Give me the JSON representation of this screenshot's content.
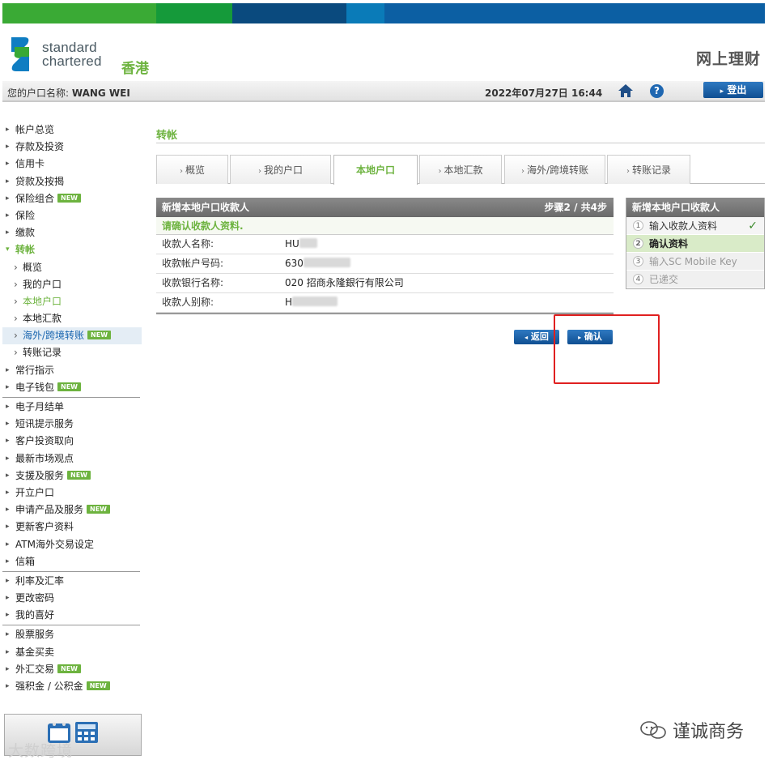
{
  "header": {
    "brand_line1": "standard",
    "brand_line2": "chartered",
    "brand_region": "香港",
    "service_title": "网上理财",
    "colors": {
      "bar_green1": "#3aaa35",
      "bar_green2": "#159a3a",
      "bar_navy": "#0a4a7e",
      "bar_teal": "#0a7bb8",
      "bar_blue": "#0c5fa3",
      "accent_green": "#6db33f"
    }
  },
  "userbar": {
    "account_label": "您的户口名称:",
    "account_name": "WANG WEI",
    "datetime": "2022年07月27日 16:44",
    "home_icon": "home-icon",
    "help_icon": "help-icon",
    "help_glyph": "?",
    "logout_label": "登出"
  },
  "sidebar": {
    "group1": [
      {
        "label": "帐户总览"
      },
      {
        "label": "存款及投资"
      },
      {
        "label": "信用卡"
      },
      {
        "label": "贷款及按揭"
      },
      {
        "label": "保险组合",
        "badge": "NEW"
      },
      {
        "label": "保险"
      },
      {
        "label": "缴款"
      },
      {
        "label": "转帐"
      }
    ],
    "transfer_sub": [
      {
        "label": "概览"
      },
      {
        "label": "我的户口"
      },
      {
        "label": "本地户口"
      },
      {
        "label": "本地汇款"
      },
      {
        "label": "海外/跨境转账",
        "badge": "NEW"
      },
      {
        "label": "转账记录"
      }
    ],
    "group1b": [
      {
        "label": "常行指示"
      },
      {
        "label": "电子钱包",
        "badge": "NEW"
      }
    ],
    "group2": [
      {
        "label": "电子月结单"
      },
      {
        "label": "短讯提示服务"
      },
      {
        "label": "客户投资取向"
      },
      {
        "label": "最新市场观点"
      },
      {
        "label": "支援及服务",
        "badge": "NEW"
      },
      {
        "label": "开立户口"
      },
      {
        "label": "申请产品及服务",
        "badge": "NEW"
      },
      {
        "label": "更新客户资料"
      },
      {
        "label": "ATM海外交易设定"
      },
      {
        "label": "信箱"
      }
    ],
    "group3": [
      {
        "label": "利率及汇率"
      },
      {
        "label": "更改密码"
      },
      {
        "label": "我的喜好"
      }
    ],
    "group4": [
      {
        "label": "股票服务"
      },
      {
        "label": "基金买卖"
      },
      {
        "label": "外汇交易",
        "badge": "NEW"
      },
      {
        "label": "强积金 / 公积金",
        "badge": "NEW"
      }
    ]
  },
  "page": {
    "title": "转帐",
    "tabs": [
      {
        "label": "概览"
      },
      {
        "label": "我的户口"
      },
      {
        "label": "本地户口"
      },
      {
        "label": "本地汇款"
      },
      {
        "label": "海外/跨境转账"
      },
      {
        "label": "转账记录"
      }
    ]
  },
  "form": {
    "panel_title": "新增本地户口收款人",
    "step_text": "步骤2 / 共4步",
    "confirm_prompt": "请确认收款人资料.",
    "rows": [
      {
        "label": "收款人名称:",
        "value": "HU"
      },
      {
        "label": "收款帐户号码:",
        "value": "630"
      },
      {
        "label": "收款银行名称:",
        "value": "020 招商永隆銀行有限公司"
      },
      {
        "label": "收款人别称:",
        "value": "H"
      }
    ],
    "back_label": "返回",
    "confirm_label": "确认"
  },
  "steps": {
    "title": "新增本地户口收款人",
    "items": [
      {
        "num": "1",
        "label": "输入收款人资料",
        "check": "✓"
      },
      {
        "num": "2",
        "label": "确认资料"
      },
      {
        "num": "3",
        "label": "输入SC Mobile Key"
      },
      {
        "num": "4",
        "label": "已递交"
      }
    ]
  },
  "watermarks": {
    "right": "谨诚商务",
    "left": "大数跨境"
  }
}
